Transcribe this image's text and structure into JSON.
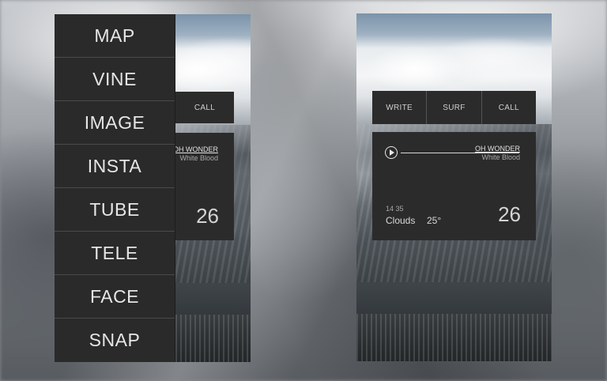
{
  "menu": {
    "items": [
      "MAP",
      "VINE",
      "IMAGE",
      "INSTA",
      "TUBE",
      "TELE",
      "FACE",
      "SNAP"
    ]
  },
  "left_screen": {
    "visible_button": "CALL",
    "artist": "OH WONDER",
    "track": "White Blood",
    "day": "26"
  },
  "right_screen": {
    "buttons": [
      "WRITE",
      "SURF",
      "CALL"
    ],
    "artist": "OH WONDER",
    "track": "White Blood",
    "time": "14 35",
    "condition": "Clouds",
    "temperature": "25°",
    "day": "26"
  },
  "colors": {
    "panel": "#2b2b2b",
    "menu": "#2a2a2a",
    "text": "#e6e6e6"
  }
}
